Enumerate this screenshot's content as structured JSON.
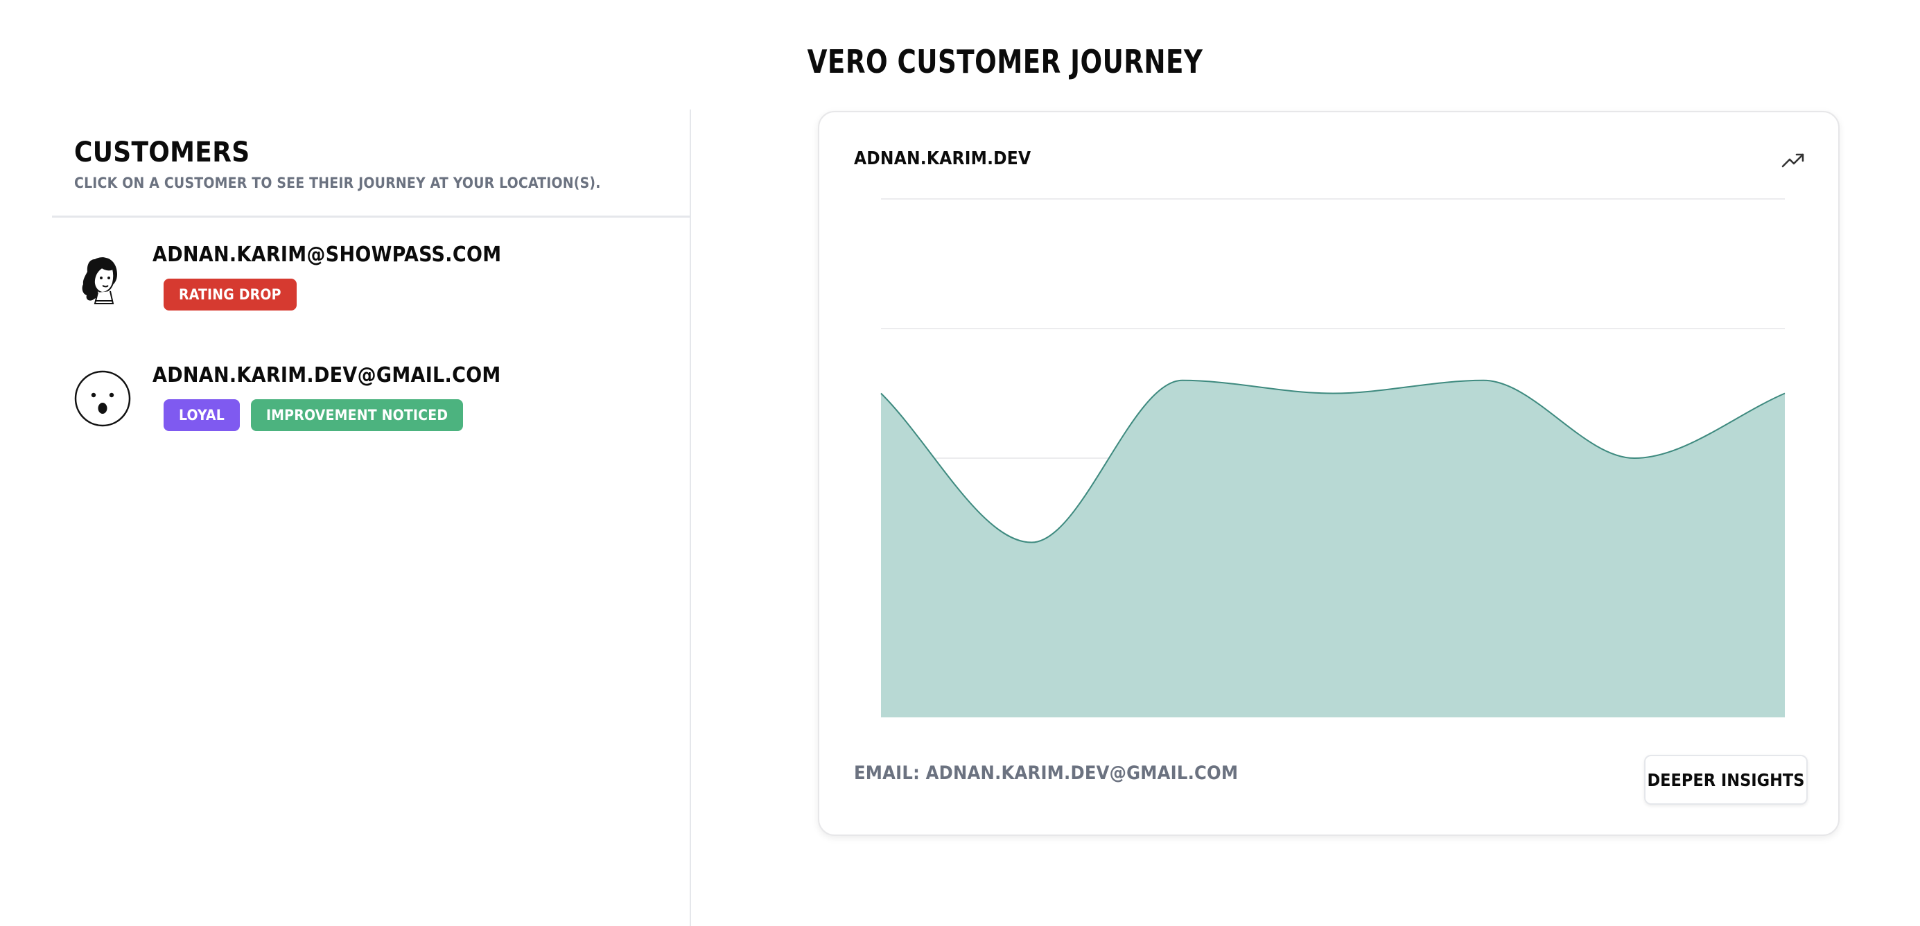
{
  "page": {
    "title": "Vero Customer Journey"
  },
  "sidebar": {
    "title": "Customers",
    "subtitle": "Click on a customer to see their journey at your location(s).",
    "customers": [
      {
        "email": "adnan.karim@showpass.com",
        "avatar_icon": "woman-sketch-avatar-icon",
        "badges": [
          {
            "label": "Rating Drop",
            "color": "#d63a30"
          }
        ]
      },
      {
        "email": "adnan.karim.dev@gmail.com",
        "avatar_icon": "surprised-face-avatar-icon",
        "badges": [
          {
            "label": "Loyal",
            "color": "#7f5af0"
          },
          {
            "label": "Improvement Noticed",
            "color": "#4cb37f"
          }
        ]
      }
    ]
  },
  "card": {
    "title": "adnan.karim.dev",
    "icon": "trending-up-icon",
    "email_label": "Email: ",
    "email_value": "adnan.karim.dev@gmail.com",
    "button_label": "Deeper Insights"
  },
  "chart_data": {
    "type": "area",
    "x": [
      0,
      1,
      2,
      3,
      4,
      5,
      6
    ],
    "values": [
      2.5,
      1.35,
      2.6,
      2.5,
      2.6,
      2.0,
      2.5
    ],
    "ylim": [
      0,
      4
    ],
    "grid": true,
    "fill_color": "#b8d9d4",
    "line_color": "#3e8a7f",
    "smooth": true
  }
}
